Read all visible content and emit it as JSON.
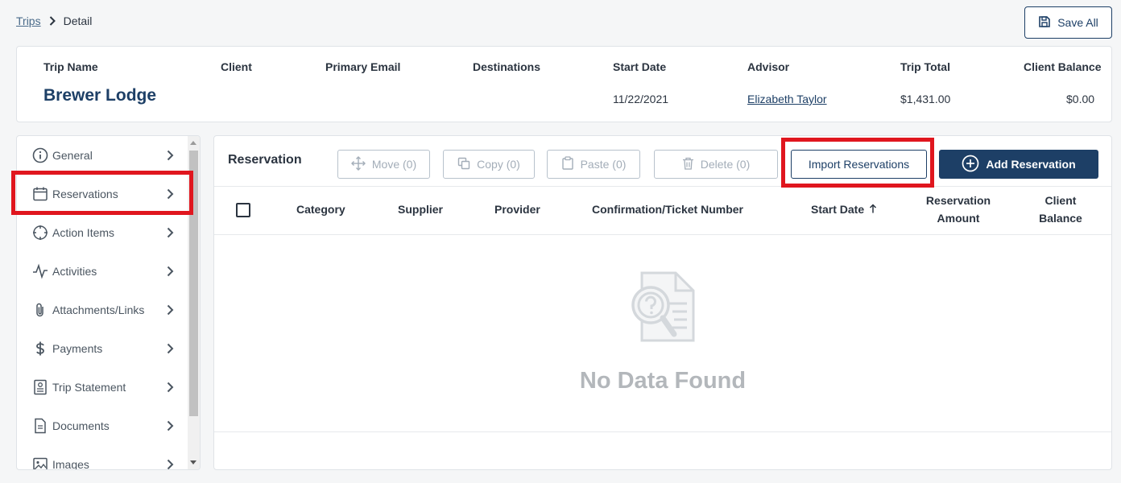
{
  "breadcrumb": {
    "parent": "Trips",
    "current": "Detail"
  },
  "save_all_label": "Save All",
  "header": {
    "columns": {
      "trip_name": "Trip Name",
      "client": "Client",
      "primary_email": "Primary Email",
      "destinations": "Destinations",
      "start_date": "Start Date",
      "advisor": "Advisor",
      "trip_total": "Trip Total",
      "client_balance": "Client Balance"
    },
    "values": {
      "trip_name": "Brewer Lodge",
      "start_date": "11/22/2021",
      "advisor": "Elizabeth Taylor",
      "trip_total": "$1,431.00",
      "client_balance": "$0.00"
    }
  },
  "sidebar": {
    "items": [
      {
        "label": "General",
        "icon": "info-icon"
      },
      {
        "label": "Reservations",
        "icon": "calendar-icon"
      },
      {
        "label": "Action Items",
        "icon": "target-icon"
      },
      {
        "label": "Activities",
        "icon": "pulse-icon"
      },
      {
        "label": "Attachments/Links",
        "icon": "paperclip-icon"
      },
      {
        "label": "Payments",
        "icon": "dollar-icon"
      },
      {
        "label": "Trip Statement",
        "icon": "statement-icon"
      },
      {
        "label": "Documents",
        "icon": "document-icon"
      },
      {
        "label": "Images",
        "icon": "image-icon"
      }
    ]
  },
  "main": {
    "title": "Reservation",
    "toolbar": {
      "move": "Move (0)",
      "copy": "Copy (0)",
      "paste": "Paste (0)",
      "delete": "Delete (0)",
      "import": "Import Reservations",
      "add": "Add Reservation"
    },
    "columns": {
      "category": "Category",
      "supplier": "Supplier",
      "provider": "Provider",
      "confirmation": "Confirmation/Ticket Number",
      "start_date": "Start Date",
      "reservation_amount_1": "Reservation",
      "reservation_amount_2": "Amount",
      "client_balance_1": "Client",
      "client_balance_2": "Balance"
    },
    "empty_text": "No Data Found"
  },
  "colors": {
    "brand": "#1d3f66",
    "highlight": "#e0161e"
  }
}
